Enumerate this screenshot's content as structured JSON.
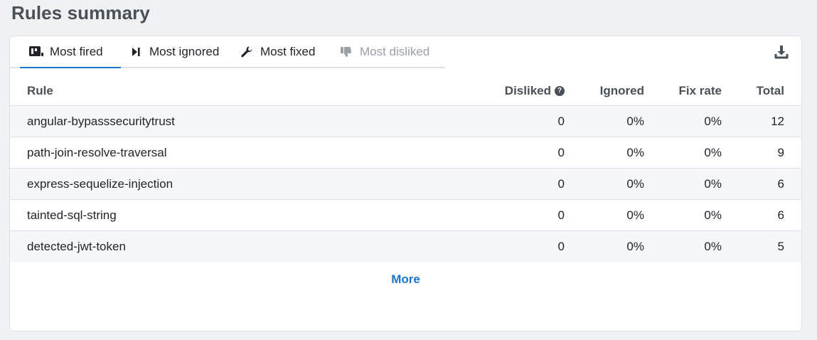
{
  "page": {
    "title": "Rules summary"
  },
  "tabs": [
    {
      "label": "Most fired",
      "icon": "fire-board-icon",
      "active": true,
      "disabled": false
    },
    {
      "label": "Most ignored",
      "icon": "skip-icon",
      "active": false,
      "disabled": false
    },
    {
      "label": "Most fixed",
      "icon": "wrench-icon",
      "active": false,
      "disabled": false
    },
    {
      "label": "Most disliked",
      "icon": "thumbs-down-icon",
      "active": false,
      "disabled": true
    }
  ],
  "toolbar": {
    "download_icon": "download-icon"
  },
  "table": {
    "columns": {
      "rule": "Rule",
      "disliked": "Disliked",
      "ignored": "Ignored",
      "fix_rate": "Fix rate",
      "total": "Total"
    },
    "help_glyph": "?",
    "rows": [
      {
        "rule": "angular-bypasssecuritytrust",
        "disliked": "0",
        "ignored": "0%",
        "fix_rate": "0%",
        "total": "12"
      },
      {
        "rule": "path-join-resolve-traversal",
        "disliked": "0",
        "ignored": "0%",
        "fix_rate": "0%",
        "total": "9"
      },
      {
        "rule": "express-sequelize-injection",
        "disliked": "0",
        "ignored": "0%",
        "fix_rate": "0%",
        "total": "6"
      },
      {
        "rule": "tainted-sql-string",
        "disliked": "0",
        "ignored": "0%",
        "fix_rate": "0%",
        "total": "6"
      },
      {
        "rule": "detected-jwt-token",
        "disliked": "0",
        "ignored": "0%",
        "fix_rate": "0%",
        "total": "5"
      }
    ],
    "more_label": "More"
  },
  "colors": {
    "accent": "#1976d2",
    "background": "#f0f1f2",
    "stripe": "#f6f7f8",
    "border": "#dee2e6"
  }
}
